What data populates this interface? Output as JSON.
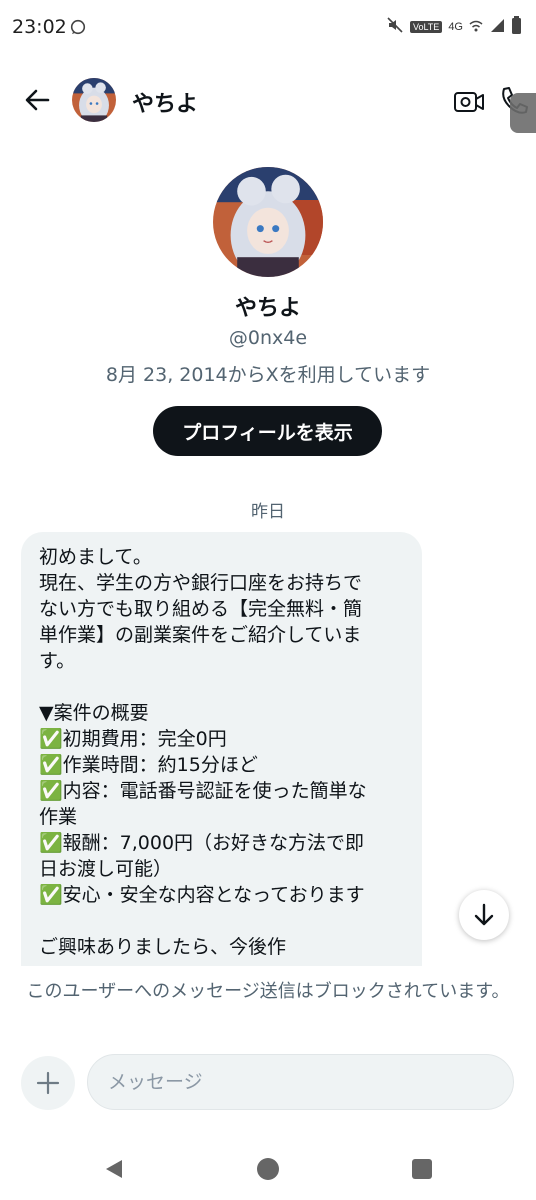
{
  "status": {
    "time": "23:02",
    "volte": "VoLTE",
    "network": "4G"
  },
  "header": {
    "title": "やちよ"
  },
  "profile": {
    "name": "やちよ",
    "handle": "@0nx4e",
    "joined": "8月 23, 2014からXを利用しています",
    "view_button": "プロフィールを表示"
  },
  "conversation": {
    "date_separator": "昨日",
    "message_lines": [
      "初めまして。",
      "現在、学生の方や銀行口座をお持ちで",
      "ない方でも取り組める【完全無料・簡",
      "単作業】の副業案件をご紹介していま",
      "す。",
      "",
      "▼案件の概要",
      "✅初期費用：完全0円",
      "✅作業時間：約15分ほど",
      "✅内容：電話番号認証を使った簡単な",
      "作業",
      "✅報酬：7,000円（お好きな方法で即",
      "日お渡し可能）",
      "✅安心・安全な内容となっております",
      "",
      "ご興味ありましたら、今後作"
    ]
  },
  "blocked_notice": "このユーザーへのメッセージ送信はブロックされています。",
  "composer": {
    "placeholder": "メッセージ"
  },
  "icons": [
    "chat-status-icon",
    "mute-icon",
    "wifi-icon",
    "signal-icon",
    "battery-icon",
    "back-arrow-icon",
    "video-camera-icon",
    "phone-icon",
    "scroll-down-arrow-icon",
    "plus-icon",
    "nav-back-icon",
    "nav-home-icon",
    "nav-recents-icon"
  ],
  "colors": {
    "primary_text": "#0f1419",
    "secondary_text": "#536471",
    "bubble_bg": "#eff3f4",
    "button_bg": "#0f1419"
  }
}
